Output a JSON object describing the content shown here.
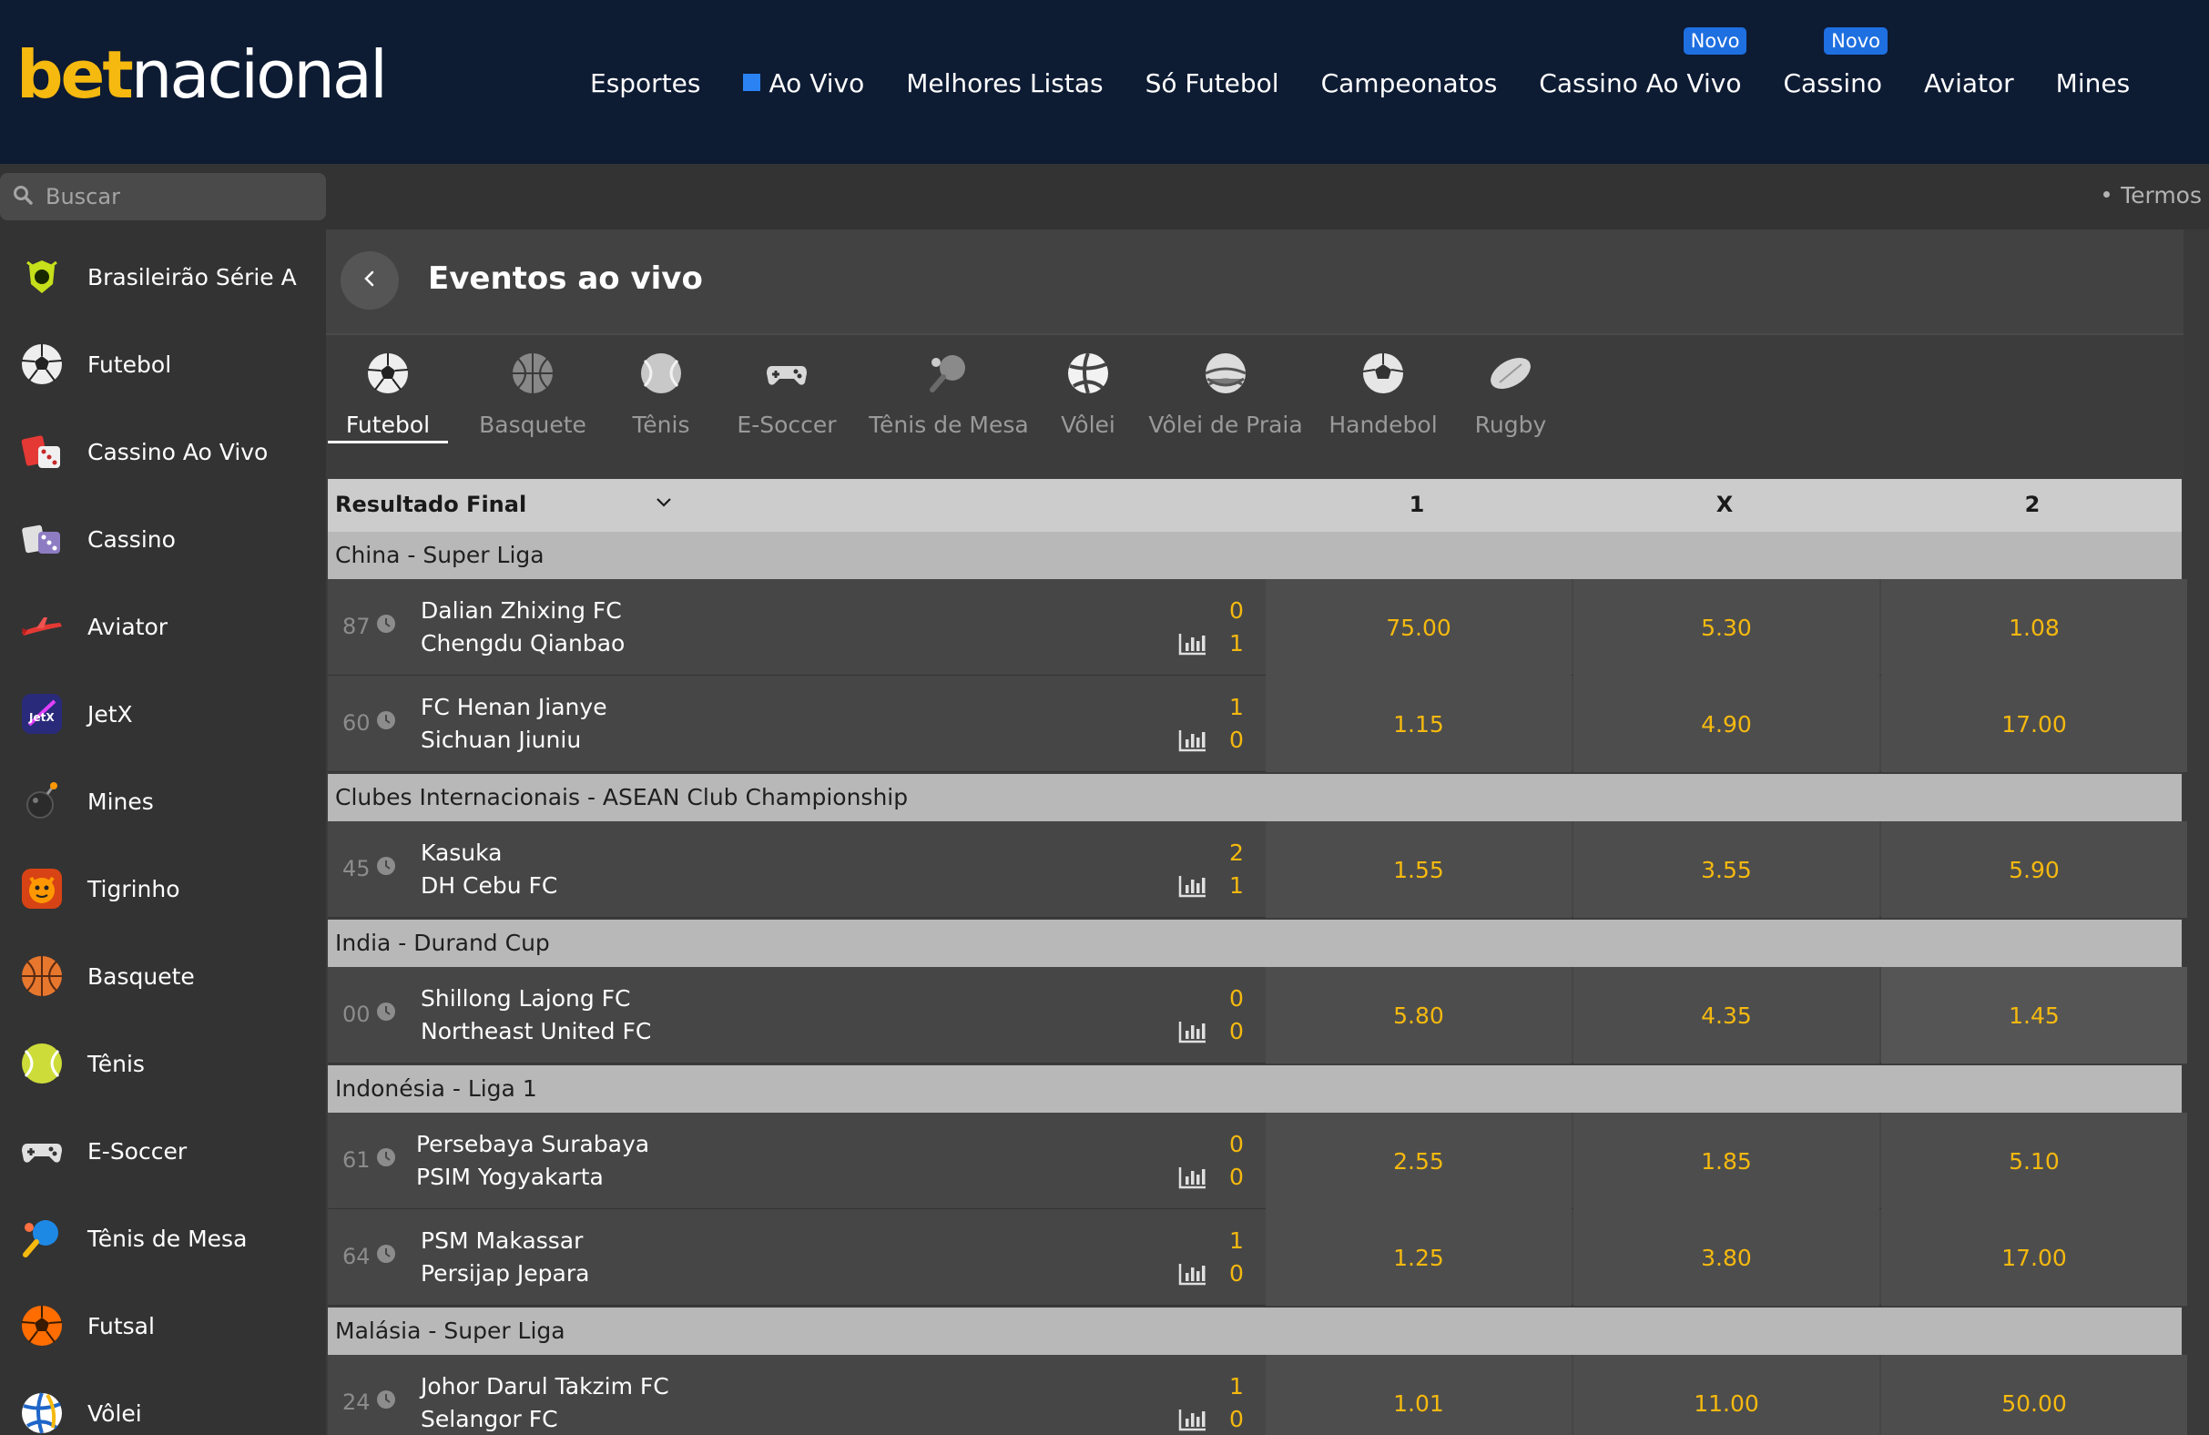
{
  "logo": {
    "part1": "bet",
    "part2": "nacional"
  },
  "nav": [
    {
      "label": "Esportes"
    },
    {
      "label": "Ao Vivo"
    },
    {
      "label": "Melhores Listas"
    },
    {
      "label": "Só Futebol"
    },
    {
      "label": "Campeonatos"
    },
    {
      "label": "Cassino Ao Vivo",
      "badge": "Novo"
    },
    {
      "label": "Cassino",
      "badge": "Novo"
    },
    {
      "label": "Aviator"
    },
    {
      "label": "Mines"
    }
  ],
  "search": {
    "placeholder": "Buscar"
  },
  "terms": "Termos",
  "sidebar": {
    "items": [
      {
        "label": "Brasileirão Série A",
        "icon": "brasileirao-icon"
      },
      {
        "label": "Futebol",
        "icon": "soccer-ball-icon"
      },
      {
        "label": "Cassino Ao Vivo",
        "icon": "live-casino-icon"
      },
      {
        "label": "Cassino",
        "icon": "casino-icon"
      },
      {
        "label": "Aviator",
        "icon": "airplane-icon"
      },
      {
        "label": "JetX",
        "icon": "jetx-icon"
      },
      {
        "label": "Mines",
        "icon": "bomb-icon"
      },
      {
        "label": "Tigrinho",
        "icon": "tiger-icon"
      },
      {
        "label": "Basquete",
        "icon": "basketball-icon"
      },
      {
        "label": "Tênis",
        "icon": "tennis-ball-icon"
      },
      {
        "label": "E-Soccer",
        "icon": "gamepad-icon"
      },
      {
        "label": "Tênis de Mesa",
        "icon": "ping-pong-icon"
      },
      {
        "label": "Futsal",
        "icon": "futsal-ball-icon"
      },
      {
        "label": "Vôlei",
        "icon": "volleyball-icon"
      }
    ]
  },
  "main": {
    "title": "Eventos ao vivo",
    "sports": [
      {
        "label": "Futebol",
        "icon": "soccer-ball-icon",
        "active": true
      },
      {
        "label": "Basquete",
        "icon": "basketball-icon"
      },
      {
        "label": "Tênis",
        "icon": "tennis-ball-icon"
      },
      {
        "label": "E-Soccer",
        "icon": "gamepad-icon"
      },
      {
        "label": "Tênis de Mesa",
        "icon": "ping-pong-icon"
      },
      {
        "label": "Vôlei",
        "icon": "volleyball-icon"
      },
      {
        "label": "Vôlei de Praia",
        "icon": "beach-volleyball-icon"
      },
      {
        "label": "Handebol",
        "icon": "handball-icon"
      },
      {
        "label": "Rugby",
        "icon": "rugby-ball-icon"
      }
    ],
    "market": {
      "selected": "Resultado Final",
      "col1": "1",
      "colx": "X",
      "col2": "2"
    },
    "leagues": [
      {
        "name": "China - Super Liga",
        "matches": [
          {
            "minute": "87",
            "home": "Dalian Zhixing FC",
            "away": "Chengdu Qianbao",
            "score_home": "0",
            "score_away": "1",
            "odd1": "75.00",
            "oddx": "5.30",
            "odd2": "1.08"
          },
          {
            "minute": "60",
            "home": "FC Henan Jianye",
            "away": "Sichuan Jiuniu",
            "score_home": "1",
            "score_away": "0",
            "odd1": "1.15",
            "oddx": "4.90",
            "odd2": "17.00"
          }
        ]
      },
      {
        "name": "Clubes Internacionais - ASEAN Club Championship",
        "matches": [
          {
            "minute": "45",
            "home": "Kasuka",
            "away": "DH Cebu FC",
            "score_home": "2",
            "score_away": "1",
            "odd1": "1.55",
            "oddx": "3.55",
            "odd2": "5.90"
          }
        ]
      },
      {
        "name": "India - Durand Cup",
        "matches": [
          {
            "minute": "00",
            "home": "Shillong Lajong FC",
            "away": "Northeast United FC",
            "score_home": "0",
            "score_away": "0",
            "odd1": "5.80",
            "oddx": "4.35",
            "odd2": "1.45"
          }
        ]
      },
      {
        "name": "Indonésia - Liga 1",
        "matches": [
          {
            "minute": "61",
            "home": "Persebaya Surabaya",
            "away": "PSIM Yogyakarta",
            "score_home": "0",
            "score_away": "0",
            "odd1": "2.55",
            "oddx": "1.85",
            "odd2": "5.10"
          },
          {
            "minute": "64",
            "home": "PSM Makassar",
            "away": "Persijap Jepara",
            "score_home": "1",
            "score_away": "0",
            "odd1": "1.25",
            "oddx": "3.80",
            "odd2": "17.00"
          }
        ]
      },
      {
        "name": "Malásia - Super Liga",
        "matches": [
          {
            "minute": "24",
            "home": "Johor Darul Takzim FC",
            "away": "Selangor FC",
            "score_home": "1",
            "score_away": "0",
            "odd1": "1.01",
            "oddx": "11.00",
            "odd2": "50.00"
          }
        ]
      }
    ]
  },
  "colors": {
    "header_bg": "#0d1b33",
    "accent_yellow": "#f5b90f",
    "badge_blue": "#1e6fe0",
    "live_blue": "#2b82f2"
  }
}
